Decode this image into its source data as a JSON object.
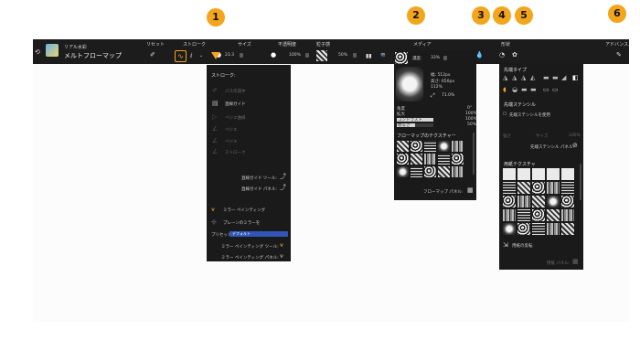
{
  "toolbar": {
    "brush_category": "リアル水彩",
    "brush_name": "メルトフローマップ",
    "reset_label": "リセット",
    "stroke_label": "ストローク",
    "size_label": "サイズ",
    "opacity_label": "不透明度",
    "grain_label": "粒子感",
    "media_label": "メディア",
    "shape_label": "形状",
    "advanced_label": "アドバンス...",
    "size_value": "23.3",
    "opacity_value": "100%",
    "grain_value": "50%"
  },
  "callouts": [
    "1",
    "2",
    "3",
    "4",
    "5",
    "6"
  ],
  "stroke_panel": {
    "title": "ストローク:",
    "items": [
      "パス作成中",
      "直線ガイド",
      "ベジエ曲線",
      "ベジエ",
      "ベジエ"
    ],
    "disabled_text": "ストローク",
    "line_guide_tool": "直線ガイド ツール:",
    "line_guide_panel": "直線ガイド パネル:",
    "mirror_painting": "ミラー ペインティング",
    "plane_mirror": "プレーンのミラーを",
    "preset_label": "プリセット:",
    "preset_value": "デフォルト",
    "mirror_tool": "ミラー ペインティング ツール:",
    "mirror_panel": "ミラー ペインティング パネル:"
  },
  "media_panel": {
    "density_label": "濃度:",
    "density_value": "33%",
    "info_w": "幅: 512px",
    "info_h": "高さ: 650px",
    "info_zoom": "112%",
    "info_pct": "71.0%",
    "row1_label": "角度",
    "row1_value": "0°",
    "row2_label": "拡大",
    "row2_value": "100%",
    "row3_label": "コントラスト",
    "row3_value": "100%",
    "row4_label": "明るさ",
    "row4_value": "50%",
    "flowmap_texture_head": "フローマップのテクスチャー",
    "flowmap_panel_label": "フローマップ パネル:"
  },
  "shape_panel": {
    "tip_type_head": "先端タイプ",
    "stencil_head": "先端ステンシル",
    "stencil_checkbox": "先端ステンシルを使用",
    "dim_label1": "強さ",
    "dim_label2": "サイズ",
    "dim_value2": "100%",
    "stencil_panel_label": "先端ステンシル パネル:",
    "texture_head": "用紙テクスチャ",
    "texture_invert": "用紙の反転",
    "texture_footer": "用紙 パネル:"
  }
}
